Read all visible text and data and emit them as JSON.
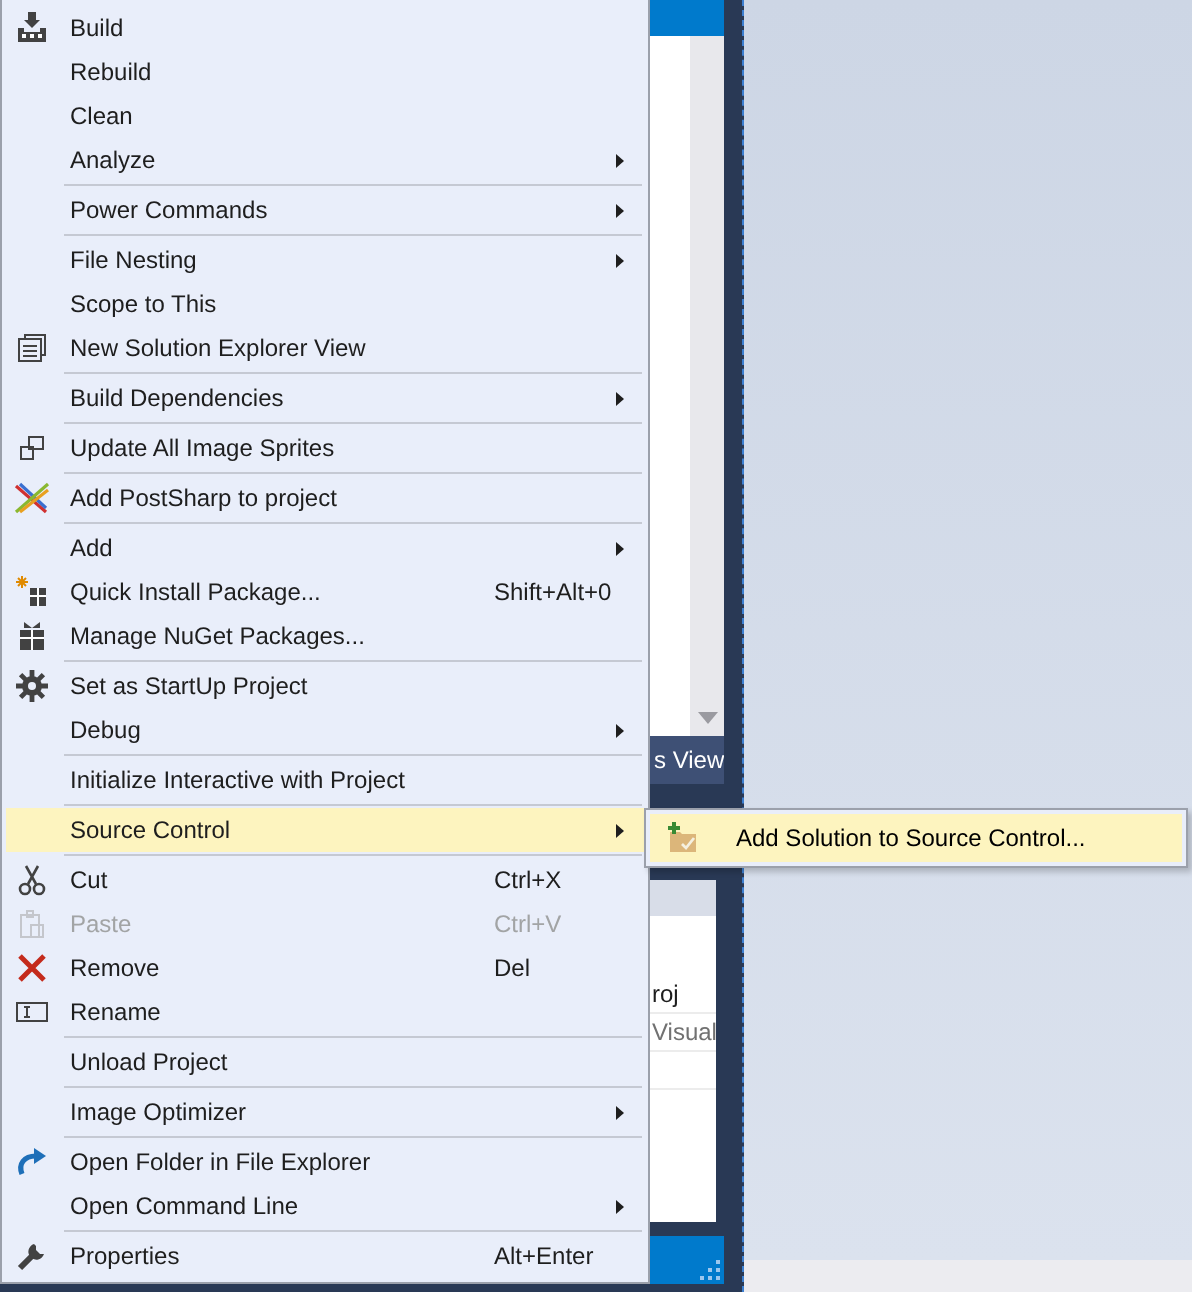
{
  "context_menu": {
    "groups": [
      [
        {
          "label": "Build",
          "submenu": false,
          "disabled": false,
          "selected": false
        },
        {
          "label": "Rebuild",
          "submenu": false,
          "disabled": false,
          "selected": false
        },
        {
          "label": "Clean",
          "submenu": false,
          "disabled": false,
          "selected": false
        },
        {
          "label": "Analyze",
          "submenu": true,
          "disabled": false,
          "selected": false
        }
      ],
      [
        {
          "label": "Power Commands",
          "submenu": true,
          "disabled": false,
          "selected": false
        }
      ],
      [
        {
          "label": "File Nesting",
          "submenu": true,
          "disabled": false,
          "selected": false
        },
        {
          "label": "Scope to This",
          "submenu": false,
          "disabled": false,
          "selected": false
        },
        {
          "label": "New Solution Explorer View",
          "submenu": false,
          "disabled": false,
          "selected": false
        }
      ],
      [
        {
          "label": "Build Dependencies",
          "submenu": true,
          "disabled": false,
          "selected": false
        }
      ],
      [
        {
          "label": "Update All Image Sprites",
          "submenu": false,
          "disabled": false,
          "selected": false
        }
      ],
      [
        {
          "label": "Add PostSharp to project",
          "submenu": false,
          "disabled": false,
          "selected": false
        }
      ],
      [
        {
          "label": "Add",
          "submenu": true,
          "disabled": false,
          "selected": false
        },
        {
          "label": "Quick Install Package...",
          "shortcut": "Shift+Alt+0",
          "submenu": false,
          "disabled": false,
          "selected": false
        },
        {
          "label": "Manage NuGet Packages...",
          "submenu": false,
          "disabled": false,
          "selected": false
        }
      ],
      [
        {
          "label": "Set as StartUp Project",
          "submenu": false,
          "disabled": false,
          "selected": false
        },
        {
          "label": "Debug",
          "submenu": true,
          "disabled": false,
          "selected": false
        }
      ],
      [
        {
          "label": "Initialize Interactive with Project",
          "submenu": false,
          "disabled": false,
          "selected": false
        }
      ],
      [
        {
          "label": "Source Control",
          "submenu": true,
          "disabled": false,
          "selected": true
        }
      ],
      [
        {
          "label": "Cut",
          "shortcut": "Ctrl+X",
          "submenu": false,
          "disabled": false,
          "selected": false
        },
        {
          "label": "Paste",
          "shortcut": "Ctrl+V",
          "submenu": false,
          "disabled": true,
          "selected": false
        },
        {
          "label": "Remove",
          "shortcut": "Del",
          "submenu": false,
          "disabled": false,
          "selected": false
        },
        {
          "label": "Rename",
          "submenu": false,
          "disabled": false,
          "selected": false
        }
      ],
      [
        {
          "label": "Unload Project",
          "submenu": false,
          "disabled": false,
          "selected": false
        }
      ],
      [
        {
          "label": "Image Optimizer",
          "submenu": true,
          "disabled": false,
          "selected": false
        }
      ],
      [
        {
          "label": "Open Folder in File Explorer",
          "submenu": false,
          "disabled": false,
          "selected": false
        },
        {
          "label": "Open Command Line",
          "submenu": true,
          "disabled": false,
          "selected": false
        }
      ],
      [
        {
          "label": "Properties",
          "shortcut": "Alt+Enter",
          "submenu": false,
          "disabled": false,
          "selected": false
        }
      ]
    ]
  },
  "submenu": {
    "items": [
      {
        "label": "Add Solution to Source Control...",
        "selected": true
      }
    ]
  },
  "background": {
    "tab_label": "s View",
    "rows": [
      "roj",
      "Visual"
    ]
  }
}
